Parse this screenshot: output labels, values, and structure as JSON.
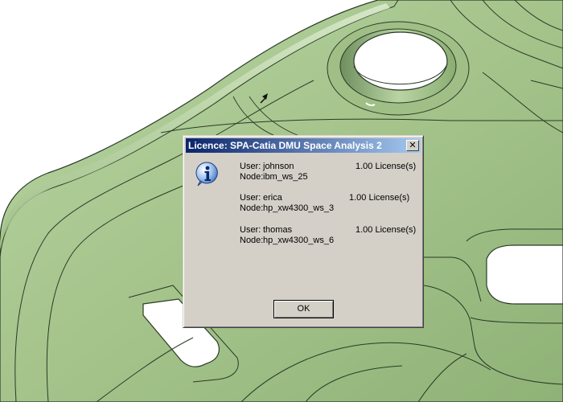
{
  "dialog": {
    "title": "Licence: SPA-Catia DMU Space Analysis 2",
    "close_glyph": "✕",
    "icon": "info-icon",
    "user_label": "User:",
    "node_label": "Node:",
    "entries": [
      {
        "user": "johnson",
        "node": "ibm_ws_25",
        "licenses": "1.00 License(s)"
      },
      {
        "user": "erica",
        "node": "hp_xw4300_ws_3",
        "licenses": "1.00 License(s)"
      },
      {
        "user": "thomas",
        "node": "hp_xw4300_ws_6",
        "licenses": "1.00 License(s)"
      }
    ],
    "ok_label": "OK"
  },
  "colors": {
    "part_green": "#a8c78f",
    "part_edge": "#2a3a26",
    "dialog_bg": "#d4d0c8",
    "titlebar_start": "#0a246a",
    "titlebar_end": "#a6caf0"
  }
}
